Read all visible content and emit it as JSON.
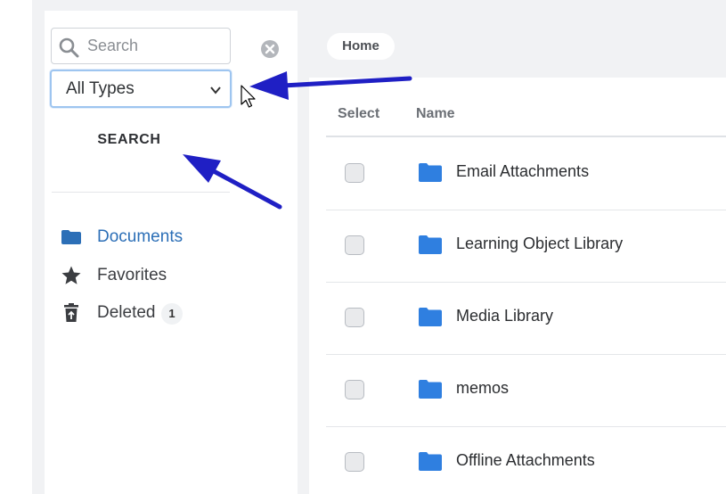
{
  "sidebar": {
    "search": {
      "placeholder": "Search",
      "value": ""
    },
    "type_filter": {
      "selected": "All Types"
    },
    "search_button": "SEARCH",
    "nav": [
      {
        "label": "Documents",
        "icon": "folder-icon",
        "active": true
      },
      {
        "label": "Favorites",
        "icon": "star-icon",
        "active": false
      },
      {
        "label": "Deleted",
        "icon": "trash-icon",
        "active": false,
        "badge": "1"
      }
    ]
  },
  "breadcrumb": {
    "home": "Home"
  },
  "table": {
    "columns": {
      "select": "Select",
      "name": "Name"
    },
    "rows": [
      {
        "name": "Email Attachments"
      },
      {
        "name": "Learning Object Library"
      },
      {
        "name": "Media Library"
      },
      {
        "name": "memos"
      },
      {
        "name": "Offline Attachments"
      }
    ]
  },
  "colors": {
    "accent": "#2c6fb7",
    "folder": "#2f7fe0",
    "annotation_arrow": "#1f1fc4",
    "page_background": "#f1f2f4"
  }
}
